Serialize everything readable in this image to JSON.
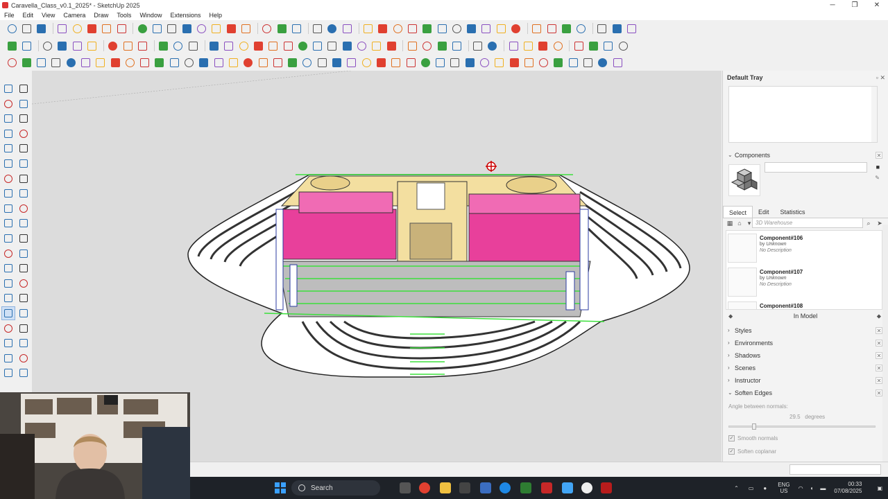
{
  "window": {
    "title": "Caravella_Class_v0.1_2025* - SketchUp 2025",
    "minimize": "─",
    "maximize": "❐",
    "close": "✕"
  },
  "menu": [
    "File",
    "Edit",
    "View",
    "Camera",
    "Draw",
    "Tools",
    "Window",
    "Extensions",
    "Help"
  ],
  "tray": {
    "title": "Default Tray",
    "components": {
      "header": "Components",
      "tabs": [
        "Select",
        "Edit",
        "Statistics"
      ],
      "search_placeholder": "3D Warehouse",
      "items": [
        {
          "name": "Component#106",
          "by": "by",
          "author": "Unknown",
          "desc": "No Description"
        },
        {
          "name": "Component#107",
          "by": "by",
          "author": "Unknown",
          "desc": "No Description"
        },
        {
          "name": "Component#108",
          "by": "",
          "author": "",
          "desc": ""
        }
      ],
      "collection": "In Model"
    },
    "panels": [
      "Styles",
      "Environments",
      "Shadows",
      "Scenes",
      "Instructor"
    ],
    "soften": {
      "header": "Soften Edges",
      "angle_label": "Angle between normals:",
      "angle_value": "29.5",
      "angle_unit": "degrees",
      "angle_fraction": 0.16,
      "smooth_label": "Smooth normals",
      "coplanar_label": "Soften coplanar"
    }
  },
  "taskbar": {
    "search": "Search",
    "lang_top": "ENG",
    "lang_bottom": "US",
    "time": "00:33",
    "date": "07/08/2025"
  },
  "colors": {
    "accent": "#2a6fb0",
    "walls": "#e8409b",
    "edge_highlight": "#3ce03c",
    "deck": "#f3dfa0"
  }
}
